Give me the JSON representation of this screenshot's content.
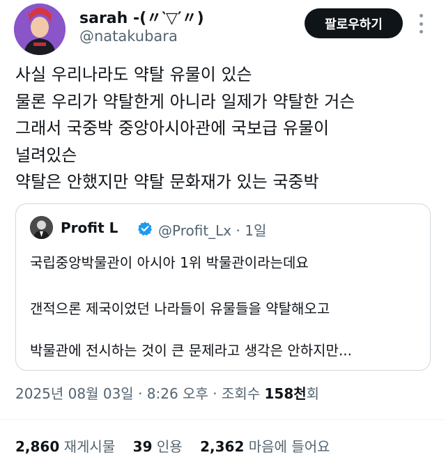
{
  "author": {
    "display_name": "sarah -(〃‵▽′〃)",
    "handle": "@natakubara",
    "avatar_icon": "anime-character-avatar"
  },
  "follow_button": {
    "label": "팔로우하기"
  },
  "more_icon": "more-options-icon",
  "tweet_lines": [
    "사실 우리나라도 약탈 유물이 있슨",
    "물론 우리가 약탈한게 아니라 일제가 약탈한 거슨",
    "그래서 국중박 중앙아시아관에 국보급 유물이",
    "널려있슨",
    "약탈은 안했지만 약탈 문화재가 있는 국중박"
  ],
  "quoted_tweet": {
    "author_name": "Profit L",
    "handle_and_time": "@Profit_Lx · 1일",
    "verified_icon": "verified-badge-icon",
    "lines": [
      "국립중앙박물관이 아시아 1위 박물관이라는데요",
      "갠적으론 제국이었던 나라들이 유물들을 약탈해오고",
      "박물관에 전시하는 것이 큰 문제라고 생각은 안하지만..."
    ]
  },
  "timestamp": {
    "text": "2025년 08월 03일 · 8:26 오후 · 조회수 ",
    "views": "158천",
    "suffix": "회"
  },
  "stats": {
    "retweets_count": "2,860",
    "retweets_label": "재게시물",
    "quotes_count": "39",
    "quotes_label": "인용",
    "likes_count": "2,362",
    "likes_label": "마음에 들어요"
  },
  "colors": {
    "text_primary": "#0f1419",
    "text_secondary": "#536471",
    "border": "#cfd9de",
    "verified": "#1d9bf0",
    "button_bg": "#0f1419"
  }
}
